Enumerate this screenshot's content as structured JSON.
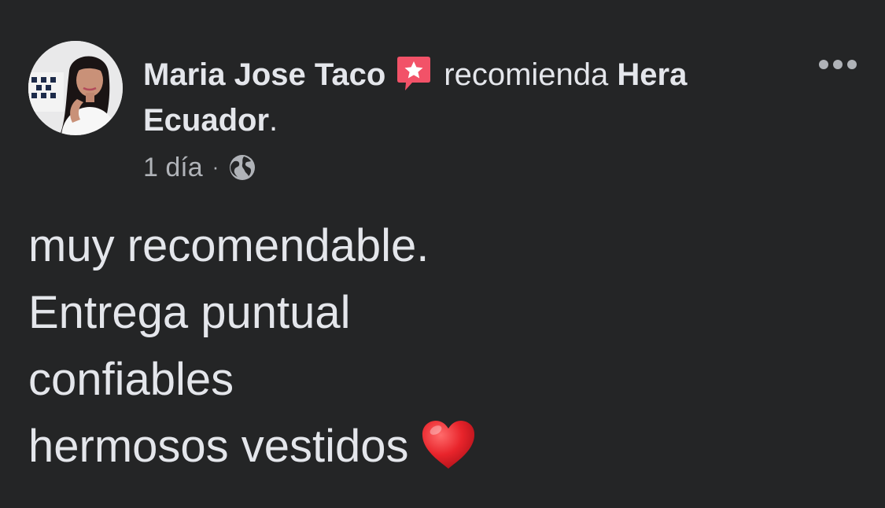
{
  "post": {
    "author_name": "Maria Jose Taco",
    "recommend_icon": "recommendation-star-icon",
    "verb": "recomienda",
    "page_name": "Hera Ecuador",
    "page_suffix": ".",
    "time": "1 día",
    "separator": "·",
    "privacy_icon": "globe-icon",
    "more_icon": "more-options-icon",
    "body_lines": [
      "muy recomendable.",
      "Entrega puntual",
      "confiables",
      "hermosos vestidos"
    ],
    "emoji": "heart-icon"
  },
  "colors": {
    "background": "#242526",
    "primary_text": "#e4e6eb",
    "secondary_text": "#b0b3b8",
    "recommend_badge": "#f25268",
    "heart": "#e8242b"
  }
}
